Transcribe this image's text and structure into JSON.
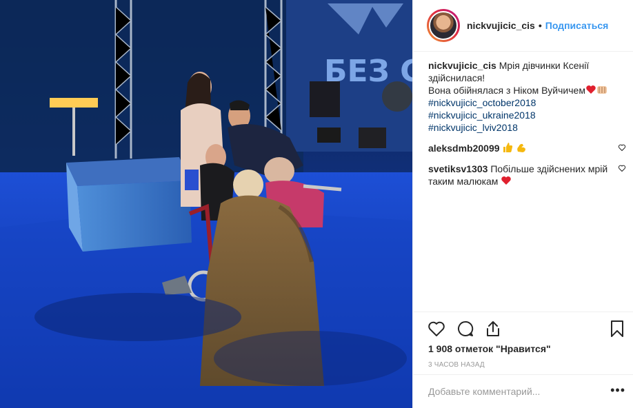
{
  "post": {
    "image_description_label": "photo",
    "banner_text": "БЕЗ С"
  },
  "header": {
    "username": "nickvujicic_cis",
    "separator": "•",
    "follow_label": "Подписаться"
  },
  "comments": [
    {
      "user": "nickvujicic_cis",
      "lines": [
        "Мрія дівчинки Ксенії",
        "здійснилася!",
        "Вона обійнялася з Ніком Вуйчичем"
      ],
      "tags": [
        "#nickvujicic_october2018",
        "#nickvujicic_ukraine2018 #nickvujicic_lviv2018"
      ]
    },
    {
      "user": "aleksdmb20099",
      "text": ""
    },
    {
      "user": "svetiksv1303",
      "text": "Побільше здійснених мрій",
      "text2": "таким малюкам"
    }
  ],
  "likes_text": "1 908 отметок \"Нравится\"",
  "time_text": "3 часов назад",
  "add_comment": {
    "placeholder": "Добавьте комментарий...",
    "more": "•••"
  },
  "icons": {
    "like": "heart-icon",
    "comment": "comment-icon",
    "share": "share-icon",
    "save": "bookmark-icon"
  },
  "colors": {
    "link": "#003569",
    "follow": "#3897f0",
    "heart": "#ed4956"
  }
}
